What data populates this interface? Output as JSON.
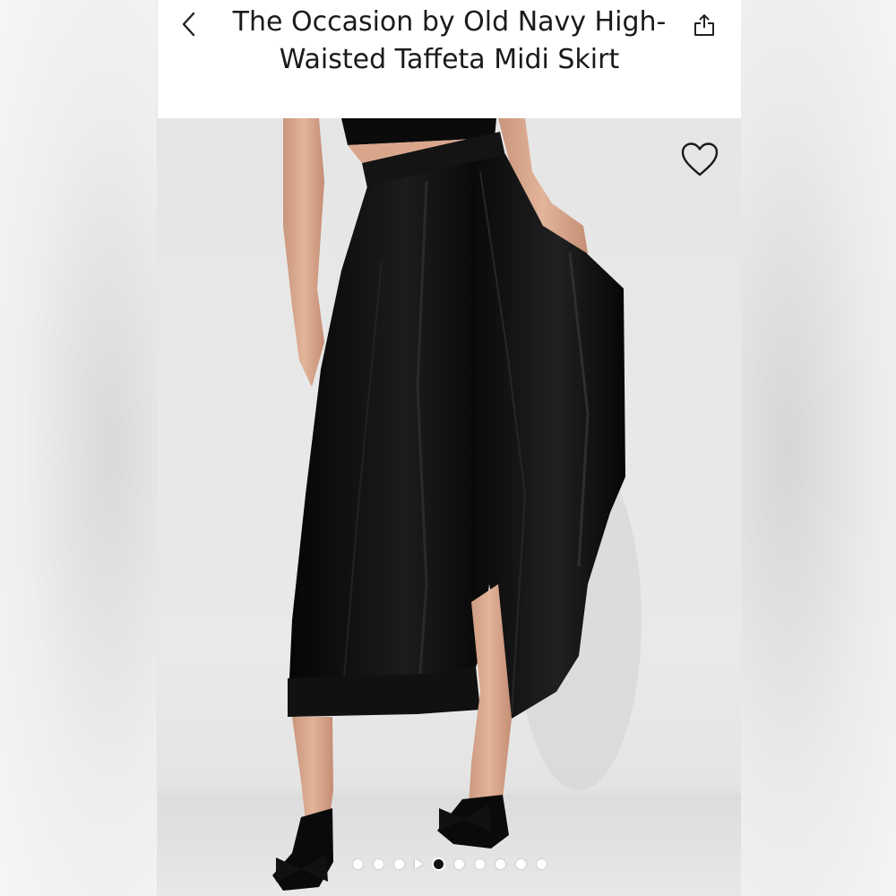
{
  "product": {
    "title": "The Occasion by Old Navy High-Waisted Taffeta Midi Skirt"
  },
  "header": {
    "back_icon": "chevron-left-icon",
    "share_icon": "share-icon"
  },
  "photo": {
    "favorite_icon": "heart-outline-icon",
    "carousel": {
      "slide_count": 9,
      "active_index": 3,
      "video_marker_before_index": 3
    }
  },
  "colors": {
    "header_bg": "#ffffff",
    "title_text": "#1a1a1a",
    "garment": "#0d0d0d",
    "backdrop": "#e6e6e6",
    "active_dot": "#111111",
    "inactive_dot": "#ffffff"
  }
}
